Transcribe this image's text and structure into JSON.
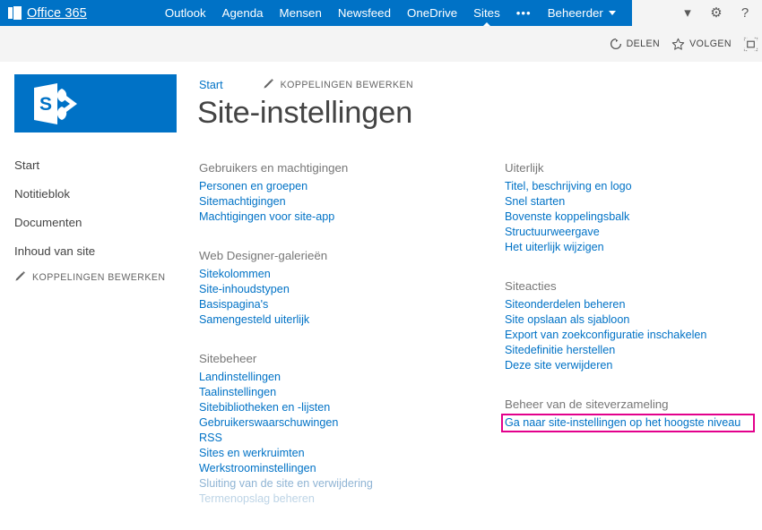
{
  "suite": {
    "brand": "Office 365",
    "brand_icon": "office-waffle-icon",
    "nav": [
      {
        "label": "Outlook",
        "active": false
      },
      {
        "label": "Agenda",
        "active": false
      },
      {
        "label": "Mensen",
        "active": false
      },
      {
        "label": "Newsfeed",
        "active": false
      },
      {
        "label": "OneDrive",
        "active": false
      },
      {
        "label": "Sites",
        "active": true
      }
    ],
    "overflow_label": "•••",
    "user_label": "Beheerder",
    "right_icons": [
      {
        "name": "chevron-down-icon",
        "glyph": "▾"
      },
      {
        "name": "gear-icon",
        "glyph": "⚙"
      },
      {
        "name": "help-icon",
        "glyph": "?"
      }
    ]
  },
  "actions": {
    "share_label": "DELEN",
    "follow_label": "VOLGEN",
    "focus_label": ""
  },
  "sidebar": {
    "logo_name": "sharepoint-logo",
    "items": [
      {
        "label": "Start"
      },
      {
        "label": "Notitieblok"
      },
      {
        "label": "Documenten"
      },
      {
        "label": "Inhoud van site"
      }
    ],
    "edit_links_label": "KOPPELINGEN BEWERKEN"
  },
  "header": {
    "breadcrumb_home": "Start",
    "edit_links_label": "KOPPELINGEN BEWERKEN",
    "title": "Site-instellingen"
  },
  "colors": {
    "suite_blue": "#0072C6",
    "link_blue": "#0072C6",
    "heading_gray": "#777777",
    "highlight_magenta": "#E3008C"
  },
  "columns": {
    "left": [
      {
        "heading": "Gebruikers en machtigingen",
        "links": [
          {
            "label": "Personen en groepen",
            "state": "normal"
          },
          {
            "label": "Sitemachtigingen",
            "state": "normal"
          },
          {
            "label": "Machtigingen voor site-app",
            "state": "normal"
          }
        ]
      },
      {
        "heading": "Web Designer-galerieën",
        "links": [
          {
            "label": "Sitekolommen",
            "state": "normal"
          },
          {
            "label": "Site-inhoudstypen",
            "state": "normal"
          },
          {
            "label": "Basispagina's",
            "state": "normal"
          },
          {
            "label": "Samengesteld uiterlijk",
            "state": "normal"
          }
        ]
      },
      {
        "heading": "Sitebeheer",
        "links": [
          {
            "label": "Landinstellingen",
            "state": "normal"
          },
          {
            "label": "Taalinstellingen",
            "state": "normal"
          },
          {
            "label": "Sitebibliotheken en -lijsten",
            "state": "normal"
          },
          {
            "label": "Gebruikerswaarschuwingen",
            "state": "normal"
          },
          {
            "label": "RSS",
            "state": "normal"
          },
          {
            "label": "Sites en werkruimten",
            "state": "normal"
          },
          {
            "label": "Werkstroominstellingen",
            "state": "normal"
          },
          {
            "label": "Sluiting van de site en verwijdering",
            "state": "faded-1"
          },
          {
            "label": "Termenopslag beheren",
            "state": "faded-2"
          }
        ]
      }
    ],
    "right": [
      {
        "heading": "Uiterlijk",
        "links": [
          {
            "label": "Titel, beschrijving en logo",
            "state": "normal"
          },
          {
            "label": "Snel starten",
            "state": "normal"
          },
          {
            "label": "Bovenste koppelingsbalk",
            "state": "normal"
          },
          {
            "label": "Structuurweergave",
            "state": "normal"
          },
          {
            "label": "Het uiterlijk wijzigen",
            "state": "normal"
          }
        ]
      },
      {
        "heading": "Siteacties",
        "links": [
          {
            "label": "Siteonderdelen beheren",
            "state": "normal"
          },
          {
            "label": "Site opslaan als sjabloon",
            "state": "normal"
          },
          {
            "label": "Export van zoekconfiguratie inschakelen",
            "state": "normal"
          },
          {
            "label": "Sitedefinitie herstellen",
            "state": "normal"
          },
          {
            "label": "Deze site verwijderen",
            "state": "normal"
          }
        ]
      },
      {
        "heading": "Beheer van de siteverzameling",
        "links": [
          {
            "label": "Ga naar site-instellingen op het hoogste niveau",
            "state": "normal",
            "highlighted": true
          }
        ]
      }
    ]
  }
}
